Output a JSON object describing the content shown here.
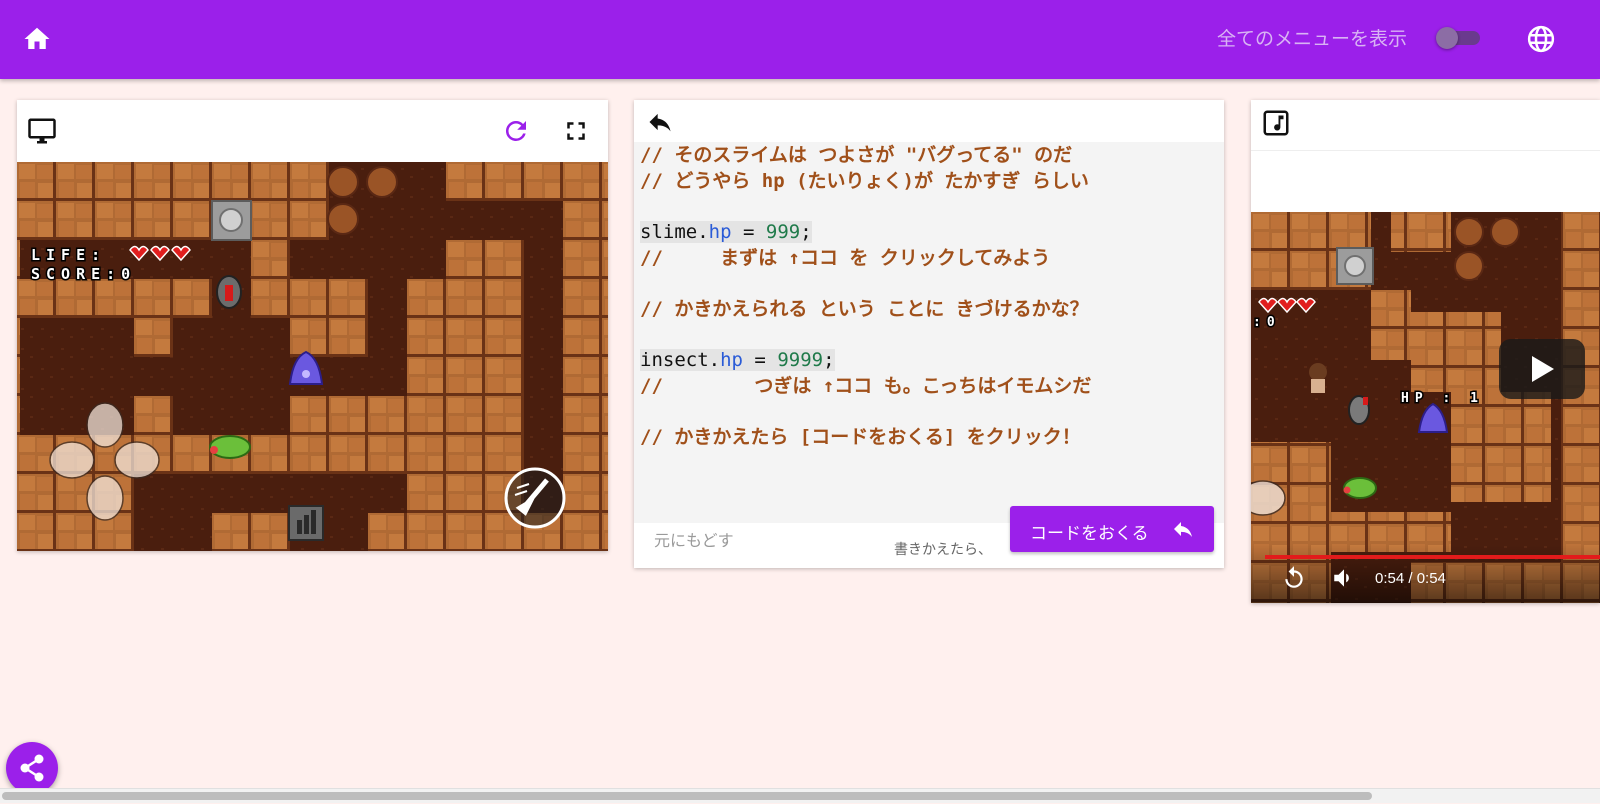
{
  "header": {
    "show_all_menu_label": "全てのメニューを表示",
    "toggle_state": "off",
    "icons": [
      "home-icon",
      "globe-icon"
    ],
    "color": "#9b20ea"
  },
  "game_panel": {
    "icons": [
      "monitor-icon",
      "reload-icon",
      "fullscreen-icon"
    ],
    "hud_life": "LIFE:",
    "hud_score": "SCORE:0",
    "hearts": 3
  },
  "code_panel": {
    "icons": [
      "undo-arrow-icon"
    ],
    "lines": [
      "// そのスライムは つよさが \"バグってる\" のだ",
      "// どうやら hp (たいりょく)が たかすぎ らしい",
      "",
      "slime.hp = 999;",
      "//     まずは ↑ココ を クリックしてみよう",
      "",
      "// かきかえられる という ことに きづけるかな？",
      "",
      "insect.hp = 9999;",
      "//        つぎは ↑ココ も。こっちはイモムシだ",
      "",
      "// かきかえたら [コードをおくる] をクリック！"
    ],
    "slime_obj": "slime",
    "slime_prop": "hp",
    "slime_eq": " = ",
    "slime_val": "999",
    "slime_semi": ";",
    "insect_obj": "insect",
    "insect_prop": "hp",
    "insect_eq": " = ",
    "insect_val": "9999",
    "insect_semi": ";",
    "undo_label": "元にもどす",
    "hint_label": "書きかえたら、",
    "send_label": "コードをおくる"
  },
  "video_panel": {
    "icons": [
      "music-note-icon",
      "replay-icon",
      "volume-icon",
      "play-icon"
    ],
    "hud_life_partial": ":0",
    "enemy_hp": "HP : 1",
    "time": "0:54 / 0:54",
    "progress": 1.0
  },
  "share": {
    "icon": "share-icon"
  }
}
